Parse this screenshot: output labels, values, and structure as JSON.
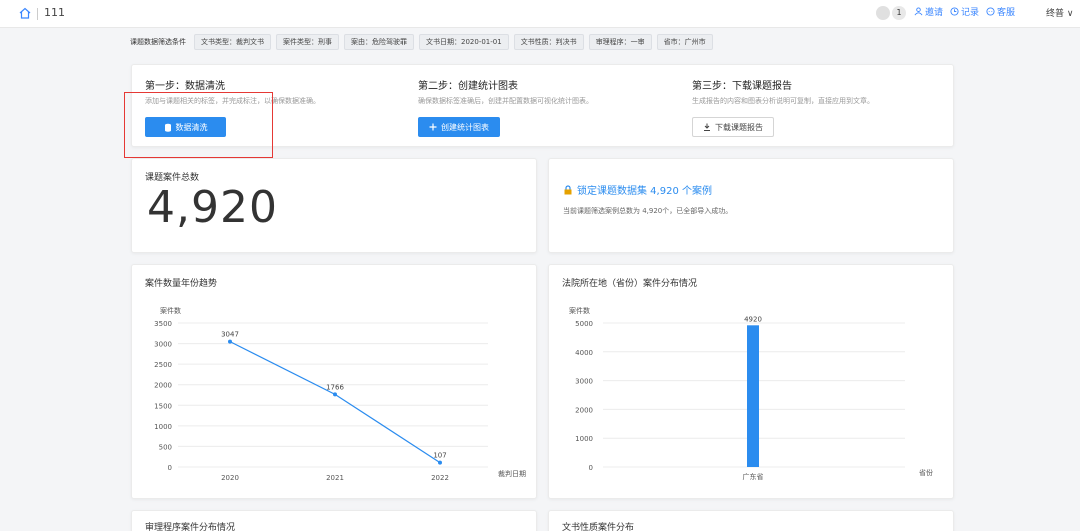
{
  "topbar": {
    "breadcrumb": "111",
    "notification_count": "1",
    "links": [
      {
        "icon": "user-icon",
        "label": "邀请"
      },
      {
        "icon": "clock-icon",
        "label": "记录"
      },
      {
        "icon": "chat-icon",
        "label": "客服"
      }
    ],
    "user": "终普 ∨"
  },
  "filters": {
    "title": "课题数据筛选条件",
    "chips": [
      "文书类型：裁判文书",
      "案件类型：刑事",
      "案由：危险驾驶罪",
      "文书日期：2020-01-01",
      "文书性质：判决书",
      "审理程序：一审",
      "省市：广州市"
    ]
  },
  "steps": [
    {
      "title": "第一步：数据清洗",
      "desc": "添加与课题相关的标签，并完成标注，以确保数据准确。",
      "button": "数据清洗",
      "icon": "database-icon",
      "primary": true
    },
    {
      "title": "第二步：创建统计图表",
      "desc": "确保数据标签准确后，创建并配置数据可视化统计图表。",
      "button": "创建统计图表",
      "icon": "plus-icon",
      "primary": true
    },
    {
      "title": "第三步：下载课题报告",
      "desc": "生成报告的内容和图表分析说明可复制，直接应用到文章。",
      "button": "下载课题报告",
      "icon": "download-icon",
      "primary": false
    }
  ],
  "total": {
    "title": "课题案件总数",
    "value": "4,920"
  },
  "lock": {
    "text": "锁定课题数据集 4,920 个案例",
    "sub": "当前课题筛选案例总数为 4,920个，已全部导入成功。"
  },
  "colors": {
    "accent": "#2b8cef",
    "highlight": "#e53935"
  },
  "chart_data": [
    {
      "type": "line",
      "title": "案件数量年份趋势",
      "ylabel": "案件数",
      "xlabel": "裁判日期",
      "categories": [
        "2020",
        "2021",
        "2022"
      ],
      "series": [
        {
          "values": [
            3047,
            1766,
            107
          ]
        }
      ],
      "ylim": [
        0,
        3500
      ],
      "yticks": [
        "0",
        "500",
        "1000",
        "1500",
        "2000",
        "2500",
        "3000",
        "3500"
      ],
      "data_labels": [
        "3047",
        "1766",
        "107"
      ],
      "grid": true
    },
    {
      "type": "bar",
      "title": "法院所在地（省份）案件分布情况",
      "ylabel": "案件数",
      "xlabel": "省份",
      "categories": [
        "广东省"
      ],
      "series": [
        {
          "values": [
            4920
          ]
        }
      ],
      "ylim": [
        0,
        5000
      ],
      "yticks": [
        "0",
        "1000",
        "2000",
        "3000",
        "4000",
        "5000"
      ],
      "data_labels": [
        "4920"
      ],
      "grid": true
    }
  ],
  "bottom": {
    "left_title": "审理程序案件分布情况",
    "right_title": "文书性质案件分布"
  }
}
